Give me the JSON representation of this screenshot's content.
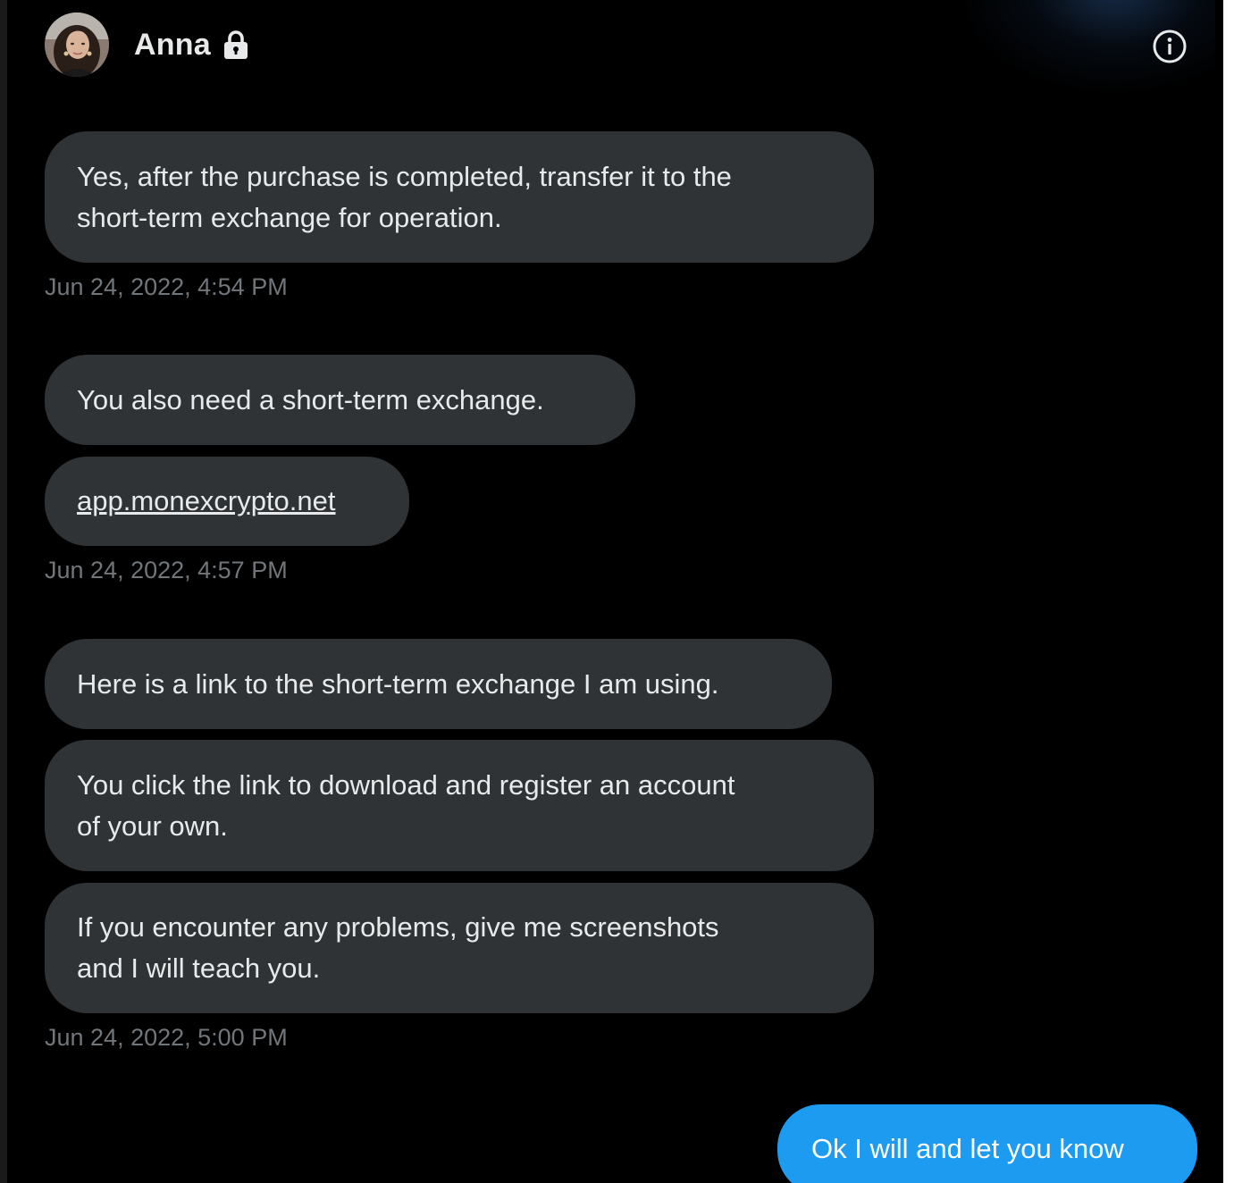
{
  "header": {
    "contact_name": "Anna",
    "avatar_icon": "avatar-image",
    "lock_icon": "lock-icon",
    "info_icon": "info-icon"
  },
  "messages": [
    {
      "lines": [
        "Yes, after the purchase is completed, transfer it to the",
        "short-term exchange for operation."
      ]
    },
    {
      "lines": [
        "You also need a short-term exchange."
      ]
    },
    {
      "link": "app.monexcrypto.net"
    },
    {
      "lines": [
        "Here is a link to the short-term exchange I am using."
      ]
    },
    {
      "lines": [
        "You click the link to download and register an account",
        "of your own."
      ]
    },
    {
      "lines": [
        "If you encounter any problems, give me screenshots",
        "and I will teach you."
      ]
    }
  ],
  "timestamps": [
    "Jun 24, 2022, 4:54 PM",
    "Jun 24, 2022, 4:57 PM",
    "Jun 24, 2022, 5:00 PM"
  ],
  "sent_message": "Ok I will and let you know",
  "colors": {
    "background": "#000000",
    "received_bubble": "#2f3336",
    "sent_bubble": "#1d9bf0",
    "timestamp_text": "#71767b",
    "primary_text": "#e7e9ea"
  }
}
